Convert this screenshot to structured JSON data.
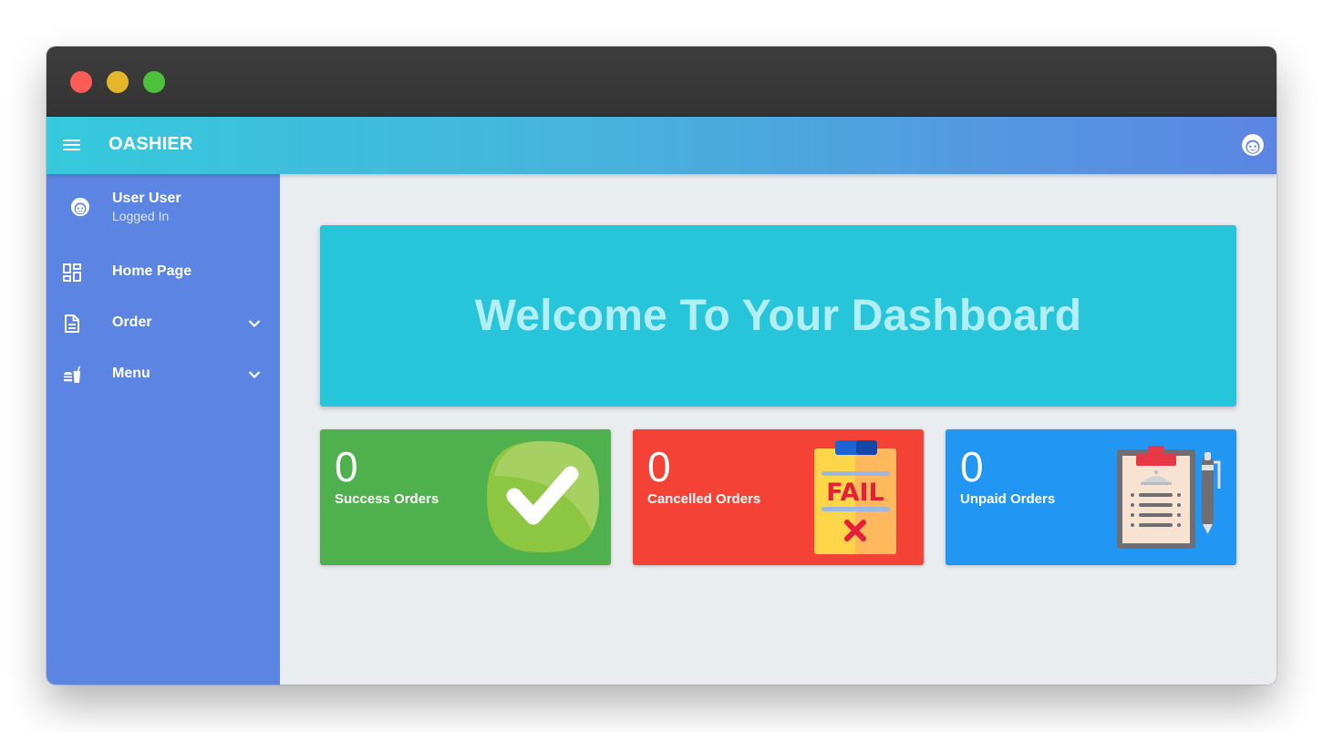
{
  "window": {
    "controls": [
      "close",
      "minimize",
      "maximize"
    ]
  },
  "appbar": {
    "title": "OASHIER",
    "menu_icon": "hamburger-menu-icon",
    "avatar_icon": "face-avatar-icon"
  },
  "sidebar": {
    "user": {
      "name": "User User",
      "status": "Logged In"
    },
    "items": [
      {
        "label": "Home Page",
        "icon": "dashboard-icon",
        "expandable": false
      },
      {
        "label": "Order",
        "icon": "document-icon",
        "expandable": true
      },
      {
        "label": "Menu",
        "icon": "fastfood-icon",
        "expandable": true
      }
    ]
  },
  "main": {
    "banner": {
      "title": "Welcome To Your Dashboard"
    },
    "cards": [
      {
        "count": "0",
        "label": "Success Orders",
        "color": "#4fb14d",
        "icon": "checkmark-badge-icon"
      },
      {
        "count": "0",
        "label": "Cancelled Orders",
        "color": "#f44336",
        "icon": "fail-clipboard-icon"
      },
      {
        "count": "0",
        "label": "Unpaid Orders",
        "color": "#2196f3",
        "icon": "order-clipboard-pen-icon"
      }
    ]
  },
  "colors": {
    "sidebar": "#5c85e3",
    "appbar_start": "#35c9dc",
    "appbar_end": "#5c85e3",
    "banner": "#26c5d9",
    "content_bg": "#eaedf0"
  }
}
